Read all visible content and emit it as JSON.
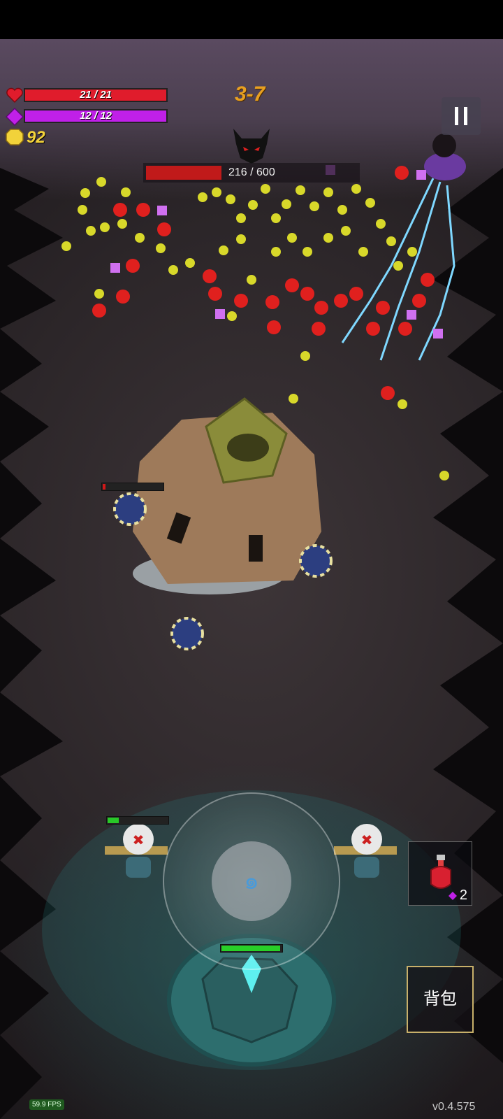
{
  "hud": {
    "health": {
      "current": 21,
      "max": 21,
      "text": "21 / 21",
      "color": "#e01c2c",
      "icon": "heart-icon"
    },
    "mana": {
      "current": 12,
      "max": 12,
      "text": "12 / 12",
      "color": "#c020e8",
      "icon": "diamond-icon"
    },
    "coins": {
      "value": "92",
      "icon": "gold-coin-icon"
    },
    "level": "3-7"
  },
  "boss": {
    "health_text": "216 / 600",
    "health_current": 216,
    "health_max": 600,
    "icon": "demon-head-icon"
  },
  "inventory": {
    "potion_count": "2",
    "potion_icon": "red-potion-icon",
    "bag_label": "背包"
  },
  "footer": {
    "fps": "59.9 FPS",
    "version": "v0.4.575"
  },
  "colors": {
    "coin": "#f2d23a",
    "level": "#e8a020",
    "player_glow": "#3cc8c8",
    "bag_border": "#c8b06a"
  },
  "units": {
    "turret_health_fraction": 0.05,
    "left_guard_health_fraction": 0.18,
    "player_health_fraction": 0.95
  }
}
